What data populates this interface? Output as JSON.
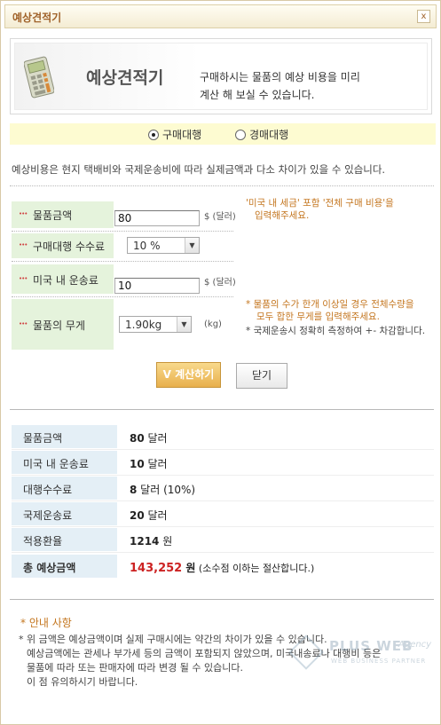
{
  "window": {
    "title": "예상견적기",
    "close_label": "x"
  },
  "banner": {
    "title": "예상견적기",
    "desc_line1": "구매하시는 물품의 예상 비용을 미리",
    "desc_line2": "계산 해 보실 수 있습니다.",
    "icon": "calculator-icon"
  },
  "service_type": {
    "options": [
      "구매대행",
      "경매대행"
    ],
    "selected": "구매대행"
  },
  "notice": "예상비용은 현지 택배비와 국제운송비에 따라 실제금액과 다소 차이가 있을 수 있습니다.",
  "form": {
    "price": {
      "label": "물품금액",
      "value": "80",
      "unit": "$ (달러)"
    },
    "price_hint1": "'미국 내 세금' 포함 '전체 구매 비용'을",
    "price_hint2": "입력해주세요.",
    "fee": {
      "label": "구매대행 수수료",
      "selected": "10 %"
    },
    "shipping": {
      "label": "미국 내 운송료",
      "value": "10",
      "unit": "$ (달러)"
    },
    "weight": {
      "label": "물품의 무게",
      "selected": "1.90kg",
      "unit": "(kg)"
    },
    "weight_hint1": "* 물품의 수가 한개 이상일 경우 전체수량을",
    "weight_hint2": "모두 합한 무게를 입력해주세요.",
    "weight_hint3": "* 국제운송시 정확히 측정하여 +- 차감합니다.",
    "calc_button": "V 계산하기",
    "close_button": "닫기"
  },
  "results": [
    {
      "label": "물품금액",
      "value": "80",
      "suffix": " 달러"
    },
    {
      "label": "미국 내 운송료",
      "value": "10",
      "suffix": " 달러"
    },
    {
      "label": "대행수수료",
      "value": "8",
      "suffix": " 달러 (10%)"
    },
    {
      "label": "국제운송료",
      "value": "20",
      "suffix": " 달러"
    },
    {
      "label": "적용환율",
      "value": "1214",
      "suffix": " 원"
    },
    {
      "label": "총 예상금액",
      "value": "143,252",
      "suffix_bold": " 원",
      "suffix": " (소수점 이하는 절산합니다.)"
    }
  ],
  "colors": {
    "total_value": "#cc2222",
    "accent": "#c4761f"
  },
  "guide": {
    "title": "* 안내 사항",
    "line1": "* 위 금액은 예상금액이며 실제 구매시에는 약간의 차이가 있을 수 있습니다.",
    "line2": "예상금액에는 관세나 부가세 등의 금액이 포함되지 않았으며, 미국내송료나 대행비 등은",
    "line3": "물품에 따라 또는 판매자에 따라 변경 될 수 있습니다.",
    "line4": "이 점 유의하시기 바랍니다."
  },
  "watermark": {
    "name": "PLUS WEB",
    "script": "Agency",
    "tagline": "WEB BUSINESS PARTNER"
  }
}
